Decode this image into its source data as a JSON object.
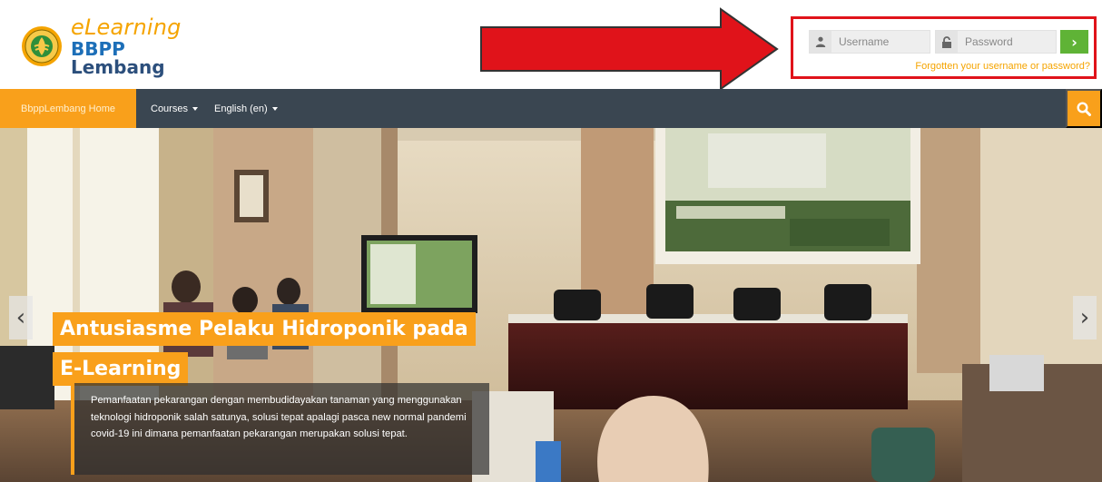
{
  "brand": {
    "line1": "eLearning",
    "line2_part1": "BBPP",
    "line2_part2": " Lembang"
  },
  "login": {
    "username_placeholder": "Username",
    "password_placeholder": "Password",
    "submit_icon": "chevron-right-icon",
    "forgot_link": "Forgotten your username or password?"
  },
  "nav": {
    "home": "BbppLembang Home",
    "courses": "Courses",
    "language": "English (en)",
    "search_icon": "search-icon"
  },
  "carousel": {
    "title": "Antusiasme Pelaku Hidroponik pada E-Learning",
    "caption": "Pemanfaatan pekarangan dengan membudidayakan tanaman yang menggunakan teknologi hidroponik salah satunya, solusi tepat apalagi pasca new normal pandemi covid-19 ini dimana pemanfaatan pekarangan merupakan solusi tepat.",
    "prev_icon": "chevron-left-icon",
    "next_icon": "chevron-right-icon"
  },
  "colors": {
    "accent": "#f9a01b",
    "nav_bg": "#3a4651",
    "login_ok": "#5fb336",
    "highlight": "#e0131a",
    "brand_blue": "#2c4f7c"
  }
}
